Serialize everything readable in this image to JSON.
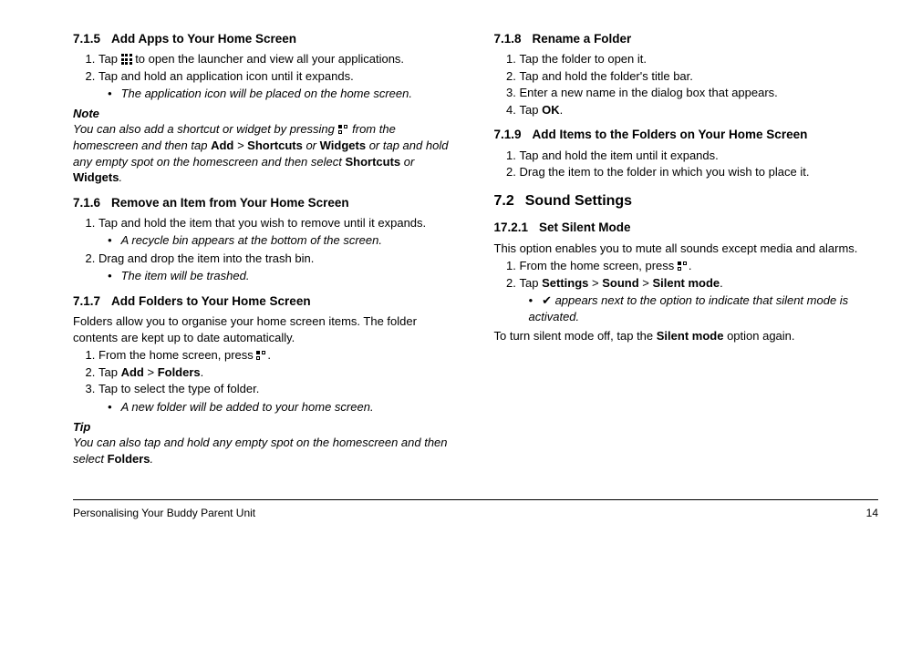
{
  "col1": {
    "s715": {
      "num": "7.1.5",
      "title": "Add Apps to Your Home Screen",
      "step1a": "Tap ",
      "step1b": " to open the launcher and view all your applications.",
      "step2": "Tap and hold an application icon until it expands.",
      "sub2": "The application icon will be placed on the home screen.",
      "noteLabel": "Note",
      "note_a": "You can also add a shortcut or widget by pressing ",
      "note_b": " from the homescreen and then tap ",
      "note_add": "Add",
      "note_gt1": " > ",
      "note_shortcuts": "Shortcuts",
      "note_or1": " or ",
      "note_widgets": "Widgets",
      "note_c": " or tap and hold any empty spot on the homescreen and then select ",
      "note_shortcuts2": "Shortcuts",
      "note_or2": " or ",
      "note_widgets2": "Widgets",
      "note_end": "."
    },
    "s716": {
      "num": "7.1.6",
      "title": "Remove an Item from Your Home Screen",
      "step1": "Tap and hold the item that you wish to remove until it expands.",
      "sub1": "A recycle bin appears at the bottom of the screen.",
      "step2": "Drag and drop the item into the trash bin.",
      "sub2": "The item will be trashed."
    },
    "s717": {
      "num": "7.1.7",
      "title": "Add Folders to Your Home Screen",
      "intro": "Folders allow you to organise your home screen items. The folder contents are kept up to date automatically.",
      "step1a": "From the home screen, press ",
      "step1b": ".",
      "step2a": "Tap ",
      "step2_add": "Add",
      "step2_gt": " > ",
      "step2_folders": "Folders",
      "step2b": ".",
      "step3": "Tap to select the type of folder.",
      "sub3": "A new folder will be added to your home screen.",
      "tipLabel": "Tip",
      "tip_a": "You can also tap and hold any empty spot on the homescreen and then select ",
      "tip_folders": "Folders",
      "tip_b": "."
    }
  },
  "col2": {
    "s718": {
      "num": "7.1.8",
      "title": "Rename a Folder",
      "step1": "Tap the folder to open it.",
      "step2": "Tap and hold the folder's title bar.",
      "step3": "Enter a new name in the dialog box that appears.",
      "step4a": "Tap ",
      "step4_ok": "OK",
      "step4b": "."
    },
    "s719": {
      "num": "7.1.9",
      "title": "Add Items to the Folders on Your Home Screen",
      "step1": "Tap and hold the item until it expands.",
      "step2": "Drag the item to the folder in which you wish to place it."
    },
    "s72": {
      "num": "7.2",
      "title": "Sound Settings"
    },
    "s1721": {
      "num": "17.2.1",
      "title": "Set Silent Mode",
      "intro": "This option enables you to mute all sounds except media and alarms.",
      "step1a": "From the home screen, press ",
      "step1b": ".",
      "step2a": "Tap ",
      "step2_settings": "Settings",
      "step2_gt1": " > ",
      "step2_sound": "Sound",
      "step2_gt2": " > ",
      "step2_silent": "Silent mode",
      "step2b": ".",
      "sub2": " appears next to the option to indicate that silent mode is activated.",
      "outro_a": "To turn silent mode off, tap the ",
      "outro_silent": "Silent mode",
      "outro_b": " option again."
    }
  },
  "footer": {
    "title": "Personalising Your Buddy Parent Unit",
    "page": "14"
  }
}
